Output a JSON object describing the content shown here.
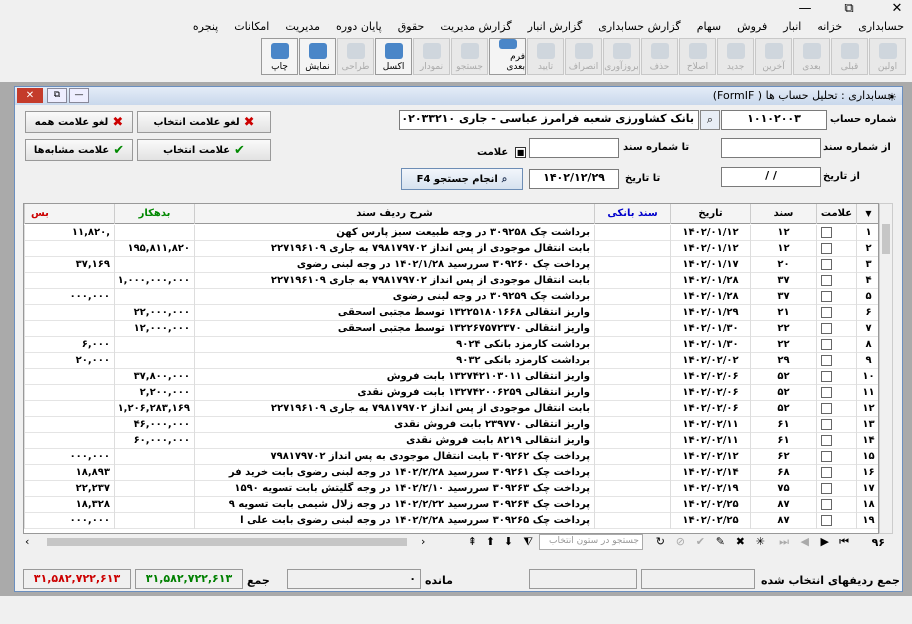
{
  "window": {
    "close": "✕",
    "restore": "⧉",
    "minimize": "—"
  },
  "menu": [
    "حسابداری",
    "خزانه",
    "انبار",
    "فروش",
    "سهام",
    "گزارش حسابداری",
    "گزارش انبار",
    "گزارش مدیریت",
    "حقوق",
    "پایان دوره",
    "مدیریت",
    "امکانات",
    "پنجره"
  ],
  "toolbar": [
    {
      "label": "اولین",
      "enabled": false
    },
    {
      "label": "قبلی",
      "enabled": false
    },
    {
      "label": "بعدی",
      "enabled": false
    },
    {
      "label": "آخرین",
      "enabled": false
    },
    {
      "label": "جدید",
      "enabled": false
    },
    {
      "label": "اصلاح",
      "enabled": false
    },
    {
      "label": "حذف",
      "enabled": false
    },
    {
      "label": "بروزآوری",
      "enabled": false
    },
    {
      "label": "انصراف",
      "enabled": false
    },
    {
      "label": "تایید",
      "enabled": false
    },
    {
      "label": "فرم بعدی",
      "enabled": true
    },
    {
      "label": "جستجو",
      "enabled": false
    },
    {
      "label": "نمودار",
      "enabled": false
    },
    {
      "label": "اکسل",
      "enabled": true
    },
    {
      "label": "طراحی",
      "enabled": false
    },
    {
      "label": "نمایش",
      "enabled": true
    },
    {
      "label": "چاپ",
      "enabled": true
    }
  ],
  "form": {
    "title": "حسابداری : تحلیل حساب ها ( FormIF)",
    "account_label": "شماره حساب",
    "account_code": "۱۰۱۰۲۰۰۳",
    "account_name": "بانک کشاورزی شعبه فرامرز عباسی - جاری ۱۰۲۰۳۳۲۱۰",
    "from_doc_label": "از شماره سند",
    "to_doc_label": "تا شماره سند",
    "mark_label": "علامت",
    "from_date_label": "از تاریخ",
    "from_date_value": "/ /",
    "to_date_label": "تا تاریخ",
    "to_date_value": "۱۴۰۲/۱۲/۲۹",
    "search_button": "انجام جستجو F4",
    "unmark_all": "لغو علامت همه",
    "unmark_selected": "لغو علامت انتخاب",
    "mark_similar": "علامت مشابه‌ها",
    "mark_selected": "علامت انتخاب"
  },
  "grid": {
    "headers": {
      "mark": "علامت",
      "doc": "سند",
      "date": "تاریخ",
      "bank_doc": "سند بانکی",
      "desc": "شرح ردیف سند",
      "credit": "بدهکار",
      "debit": "بس"
    },
    "rows": [
      {
        "n": "۱",
        "doc": "۱۲",
        "date": "۱۴۰۲/۰۱/۱۲",
        "desc": "برداشت چک ۳۰۹۲۵۸ در وجه طبیعت سبز پارس کهن",
        "credit": "",
        "debit": "۱۱,۸۲۰,"
      },
      {
        "n": "۲",
        "doc": "۱۲",
        "date": "۱۴۰۲/۰۱/۱۲",
        "desc": "بابت انتقال موجودی از پس انداز ۷۹۸۱۷۹۷۰۲ به جاری ۲۲۷۱۹۶۱۰۹",
        "credit": "۱۹۵,۸۱۱,۸۲۰",
        "debit": ""
      },
      {
        "n": "۳",
        "doc": "۲۰",
        "date": "۱۴۰۲/۰۱/۱۷",
        "desc": "پرداخت چک ۳۰۹۲۶۰ سررسید ۱۴۰۲/۱/۲۸ در وجه لبنی رضوی",
        "credit": "",
        "debit": "۳۷,۱۶۹"
      },
      {
        "n": "۴",
        "doc": "۳۷",
        "date": "۱۴۰۲/۰۱/۲۸",
        "desc": "بابت انتقال موجودی از پس انداز ۷۹۸۱۷۹۷۰۲ به جاری ۲۲۷۱۹۶۱۰۹",
        "credit": "۱,۰۰۰,۰۰۰,۰۰۰",
        "debit": ""
      },
      {
        "n": "۵",
        "doc": "۳۷",
        "date": "۱۴۰۲/۰۱/۲۸",
        "desc": "برداشت چک ۳۰۹۲۵۹ در وجه لبنی رضوی",
        "credit": "",
        "debit": "۰۰۰,۰۰۰"
      },
      {
        "n": "۶",
        "doc": "۲۱",
        "date": "۱۴۰۲/۰۱/۲۹",
        "desc": "واریز انتقالی ۱۳۲۲۵۱۸۰۱۶۶۸ توسط مجتبی اسحقی",
        "credit": "۲۲,۰۰۰,۰۰۰",
        "debit": ""
      },
      {
        "n": "۷",
        "doc": "۲۲",
        "date": "۱۴۰۲/۰۱/۳۰",
        "desc": "واریز انتقالی ۱۳۲۲۶۷۵۷۲۳۷۰ توسط مجتبی اسحقی",
        "credit": "۱۲,۰۰۰,۰۰۰",
        "debit": ""
      },
      {
        "n": "۸",
        "doc": "۲۲",
        "date": "۱۴۰۲/۰۱/۳۰",
        "desc": "برداشت کارمزد بانکی ۹۰۲۴",
        "credit": "",
        "debit": "۶,۰۰۰"
      },
      {
        "n": "۹",
        "doc": "۲۹",
        "date": "۱۴۰۲/۰۲/۰۲",
        "desc": "برداشت کارمزد بانکی ۹۰۳۲",
        "credit": "",
        "debit": "۲۰,۰۰۰"
      },
      {
        "n": "۱۰",
        "doc": "۵۲",
        "date": "۱۴۰۲/۰۲/۰۶",
        "desc": "واریز انتقالی ۱۳۲۷۴۲۱۰۳۰۱۱ بابت فروش",
        "credit": "۳۷,۸۰۰,۰۰۰",
        "debit": ""
      },
      {
        "n": "۱۱",
        "doc": "۵۲",
        "date": "۱۴۰۲/۰۲/۰۶",
        "desc": "واریز انتقالی ۱۳۲۷۴۲۰۰۶۲۵۹ بابت فروش نقدی",
        "credit": "۲,۲۰۰,۰۰۰",
        "debit": ""
      },
      {
        "n": "۱۲",
        "doc": "۵۲",
        "date": "۱۴۰۲/۰۲/۰۶",
        "desc": "بابت انتقال موجودی از پس انداز ۷۹۸۱۷۹۷۰۲ به جاری ۲۲۷۱۹۶۱۰۹",
        "credit": "۱,۲۰۶,۲۸۳,۱۶۹",
        "debit": ""
      },
      {
        "n": "۱۳",
        "doc": "۶۱",
        "date": "۱۴۰۲/۰۲/۱۱",
        "desc": "واریز انتقالی ۲۳۹۷۷۰ بابت فروش نقدی",
        "credit": "۴۶,۰۰۰,۰۰۰",
        "debit": ""
      },
      {
        "n": "۱۴",
        "doc": "۶۱",
        "date": "۱۴۰۲/۰۲/۱۱",
        "desc": "واریز انتقالی ۸۲۱۹ بابت فروش نقدی",
        "credit": "۶۰,۰۰۰,۰۰۰",
        "debit": ""
      },
      {
        "n": "۱۵",
        "doc": "۶۲",
        "date": "۱۴۰۲/۰۲/۱۲",
        "desc": "پرداخت چک ۳۰۹۲۶۲ بابت انتقال موجودی به پس انداز ۷۹۸۱۷۹۷۰۲",
        "credit": "",
        "debit": "۰۰۰,۰۰۰"
      },
      {
        "n": "۱۶",
        "doc": "۶۸",
        "date": "۱۴۰۲/۰۲/۱۴",
        "desc": "پرداخت چک ۳۰۹۲۶۱ سررسید ۱۴۰۲/۲/۲۸ در وجه لبنی رضوی بابت خرید فر",
        "credit": "",
        "debit": "۱۸,۸۹۳"
      },
      {
        "n": "۱۷",
        "doc": "۷۵",
        "date": "۱۴۰۲/۰۲/۱۹",
        "desc": "پرداخت چک ۳۰۹۲۶۳ سررسید ۱۴۰۲/۲/۱۰ در وجه گلیتش بابت تسویه ۱۵۹۰",
        "credit": "",
        "debit": "۲۲,۲۳۷"
      },
      {
        "n": "۱۸",
        "doc": "۸۷",
        "date": "۱۴۰۲/۰۲/۲۵",
        "desc": "پرداخت چک ۳۰۹۲۶۴ سررسید ۱۴۰۲/۲/۲۲ در وجه زلال شیمی بابت تسویه ۹",
        "credit": "",
        "debit": "۱۸,۳۲۸"
      },
      {
        "n": "۱۹",
        "doc": "۸۷",
        "date": "۱۴۰۲/۰۲/۲۵",
        "desc": "پرداخت چک ۳۰۹۲۶۵ سررسید ۱۴۰۲/۲/۲۸ در وجه لبنی رضوی بابت علی ا",
        "credit": "",
        "debit": "۰۰۰,۰۰۰"
      }
    ]
  },
  "nav": {
    "count": "۹۶",
    "search_placeholder": "جستجو در ستون انتخاب"
  },
  "footer": {
    "selected_label": "جمع ردیفهای انتخاب شده",
    "remain_label": "مانده",
    "remain_value": "۰",
    "sum_label": "جمع",
    "sum_credit": "۳۱,۵۸۲,۷۲۲,۶۱۳",
    "sum_debit": "۳۱,۵۸۲,۷۲۲,۶۱۳"
  },
  "colors": {
    "credit": "#008000",
    "debit": "#cc0000",
    "bank_doc": "#0000cc"
  }
}
